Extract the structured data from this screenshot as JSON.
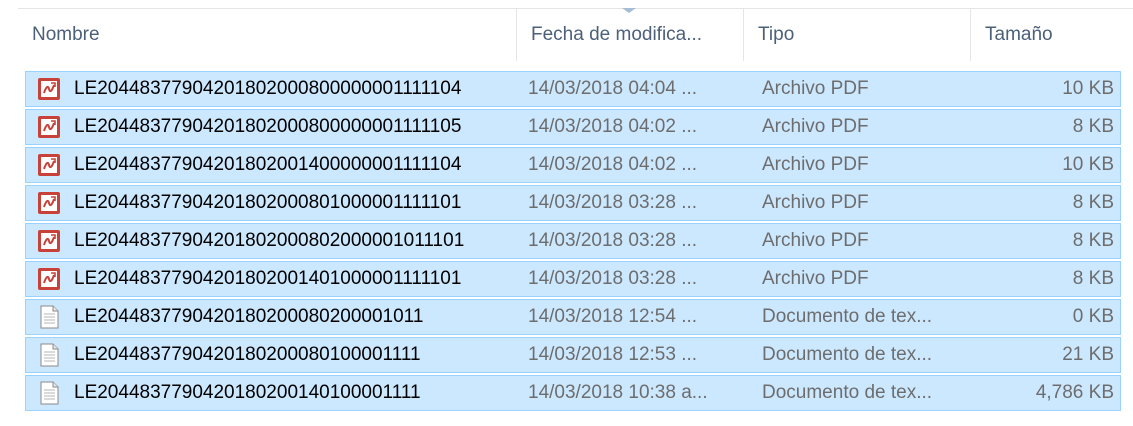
{
  "columns": {
    "name": "Nombre",
    "date": "Fecha de modifica...",
    "type": "Tipo",
    "size": "Tamaño"
  },
  "sort": {
    "column": "date",
    "direction": "descending"
  },
  "colors": {
    "selection_bg": "#cce8ff",
    "selection_border": "#99d1ff",
    "header_text": "#4c607a",
    "pdf_icon": "#c8423a"
  },
  "files": [
    {
      "name": "LE20448377904201802000800000001111104",
      "date": "14/03/2018 04:04 ...",
      "type": "Archivo PDF",
      "size": "10 KB",
      "icon": "pdf-icon"
    },
    {
      "name": "LE20448377904201802000800000001111105",
      "date": "14/03/2018 04:02 ...",
      "type": "Archivo PDF",
      "size": "8 KB",
      "icon": "pdf-icon"
    },
    {
      "name": "LE20448377904201802001400000001111104",
      "date": "14/03/2018 04:02 ...",
      "type": "Archivo PDF",
      "size": "10 KB",
      "icon": "pdf-icon"
    },
    {
      "name": "LE20448377904201802000801000001111101",
      "date": "14/03/2018 03:28 ...",
      "type": "Archivo PDF",
      "size": "8 KB",
      "icon": "pdf-icon"
    },
    {
      "name": "LE20448377904201802000802000001011101",
      "date": "14/03/2018 03:28 ...",
      "type": "Archivo PDF",
      "size": "8 KB",
      "icon": "pdf-icon"
    },
    {
      "name": "LE20448377904201802001401000001111101",
      "date": "14/03/2018 03:28 ...",
      "type": "Archivo PDF",
      "size": "8 KB",
      "icon": "pdf-icon"
    },
    {
      "name": "LE2044837790420180200080200001011",
      "date": "14/03/2018 12:54 ...",
      "type": "Documento de tex...",
      "size": "0 KB",
      "icon": "text-document-icon"
    },
    {
      "name": "LE2044837790420180200080100001111",
      "date": "14/03/2018 12:53 ...",
      "type": "Documento de tex...",
      "size": "21 KB",
      "icon": "text-document-icon"
    },
    {
      "name": "LE2044837790420180200140100001111",
      "date": "14/03/2018 10:38 a...",
      "type": "Documento de tex...",
      "size": "4,786 KB",
      "icon": "text-document-icon"
    }
  ]
}
